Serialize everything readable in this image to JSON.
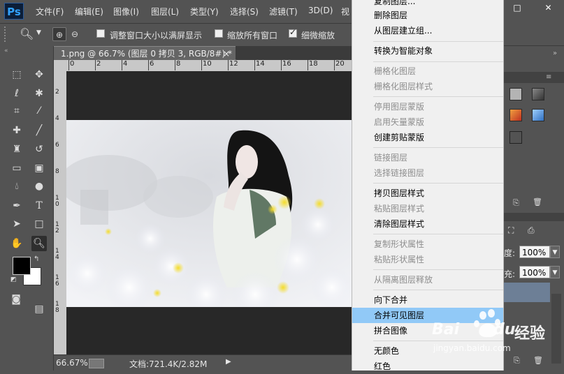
{
  "app": {
    "logo": "Ps"
  },
  "menubar": {
    "items": [
      "文件(F)",
      "编辑(E)",
      "图像(I)",
      "图层(L)",
      "类型(Y)",
      "选择(S)",
      "滤镜(T)",
      "3D(D)",
      "视"
    ],
    "window_buttons": [
      "–",
      "□",
      "✕"
    ]
  },
  "options": {
    "zoom_in_icon": "zoom-in-icon",
    "zoom_out_icon": "zoom-out-icon",
    "resize_windows": {
      "label": "调整窗口大小以满屏显示",
      "checked": false
    },
    "zoom_all": {
      "label": "缩放所有窗口",
      "checked": false
    },
    "scrubby_zoom": {
      "label": "细微缩放",
      "checked": true
    }
  },
  "document": {
    "tab_title": "1.png @ 66.7% (图层 0 拷贝 3, RGB/8#) *",
    "close": "×",
    "ruler_h": [
      "0",
      "2",
      "4",
      "6",
      "8",
      "10",
      "12",
      "14",
      "16",
      "18",
      "20"
    ],
    "ruler_v": [
      "2",
      "4",
      "6",
      "8",
      "10",
      "12",
      "14",
      "16",
      "18"
    ]
  },
  "status": {
    "zoom": "66.67%",
    "doc_info": "文档:721.4K/2.82M",
    "arrow": "▶"
  },
  "context_menu": {
    "items": [
      {
        "label": "复制图层...",
        "enabled": true
      },
      {
        "label": "删除图层",
        "enabled": true
      },
      {
        "label": "从图层建立组...",
        "enabled": true
      },
      {
        "label": "转换为智能对象",
        "enabled": true
      },
      {
        "label": "栅格化图层",
        "enabled": false
      },
      {
        "label": "栅格化图层样式",
        "enabled": false
      },
      {
        "label": "停用图层蒙版",
        "enabled": false
      },
      {
        "label": "启用矢量蒙版",
        "enabled": false
      },
      {
        "label": "创建剪贴蒙版",
        "enabled": true
      },
      {
        "label": "链接图层",
        "enabled": false
      },
      {
        "label": "选择链接图层",
        "enabled": false
      },
      {
        "label": "拷贝图层样式",
        "enabled": true
      },
      {
        "label": "粘贴图层样式",
        "enabled": false
      },
      {
        "label": "清除图层样式",
        "enabled": true
      },
      {
        "label": "复制形状属性",
        "enabled": false
      },
      {
        "label": "粘贴形状属性",
        "enabled": false
      },
      {
        "label": "从隔离图层释放",
        "enabled": false
      },
      {
        "label": "向下合并",
        "enabled": true
      },
      {
        "label": "合并可见图层",
        "enabled": true,
        "highlighted": true
      },
      {
        "label": "拼合图像",
        "enabled": true
      },
      {
        "label": "无颜色",
        "enabled": true
      },
      {
        "label": "红色",
        "enabled": true
      }
    ]
  },
  "layers_panel": {
    "opacity_label": "度:",
    "opacity_value": "100%",
    "fill_label": "充:",
    "fill_value": "100%"
  },
  "watermark": {
    "brand": "Bai",
    "brand_paw": "du",
    "suffix": "经验",
    "url": "jingyan.baidu.com"
  },
  "colors": {
    "ui_bg": "#535353",
    "menu_bg": "#f0f0f0",
    "menu_highlight": "#91c9f7",
    "ps_blue": "#32a2ff"
  }
}
